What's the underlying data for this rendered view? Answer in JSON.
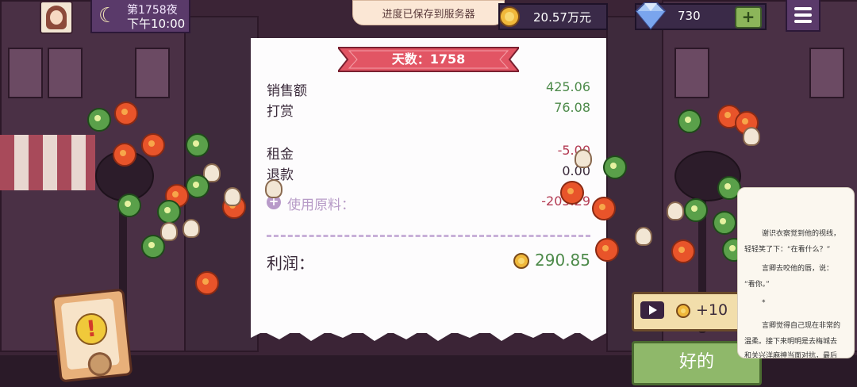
{
  "hud": {
    "day_label": "第1758夜",
    "time_label": "下午10:00",
    "save_toast": "进度已保存到服务器",
    "coins": "20.57万元",
    "gems": "730",
    "add_label": "+"
  },
  "receipt": {
    "title": "天数：1758",
    "sales_label": "销售额",
    "sales_value": "425.06",
    "tips_label": "打赏",
    "tips_value": "76.08",
    "rent_label": "租金",
    "rent_value": "-5.00",
    "refund_label": "退款",
    "refund_value": "0.00",
    "ingredients_label": "使用原料：",
    "ingredients_value": "-205.29",
    "profit_label": "利润：",
    "profit_value": "290.85"
  },
  "actions": {
    "ad_reward": "+10",
    "ok_label": "好的"
  },
  "reader": {
    "line1": "谢识衣察觉到他的视线，",
    "line2": "轻轻笑了下：“在看什么？”",
    "line3": "言卿去咬他的唇，说：",
    "line4": "“看你。”",
    "line5": "*",
    "line6": "言卿觉得自己现在非常的",
    "line7": "温柔。接下来明明是去梅城去",
    "line8": "和关兴洋麻神当面对抗，最后"
  },
  "colors": {
    "accent_green": "#4d8a4a",
    "negative_red": "#b33a52",
    "ribbon_red": "#e25564",
    "ok_green": "#8fb86a"
  },
  "icons": [
    "moon-icon",
    "coin-icon",
    "gem-icon",
    "plus-icon",
    "menu-icon",
    "alert-icon",
    "play-icon",
    "plus-circle-icon"
  ]
}
